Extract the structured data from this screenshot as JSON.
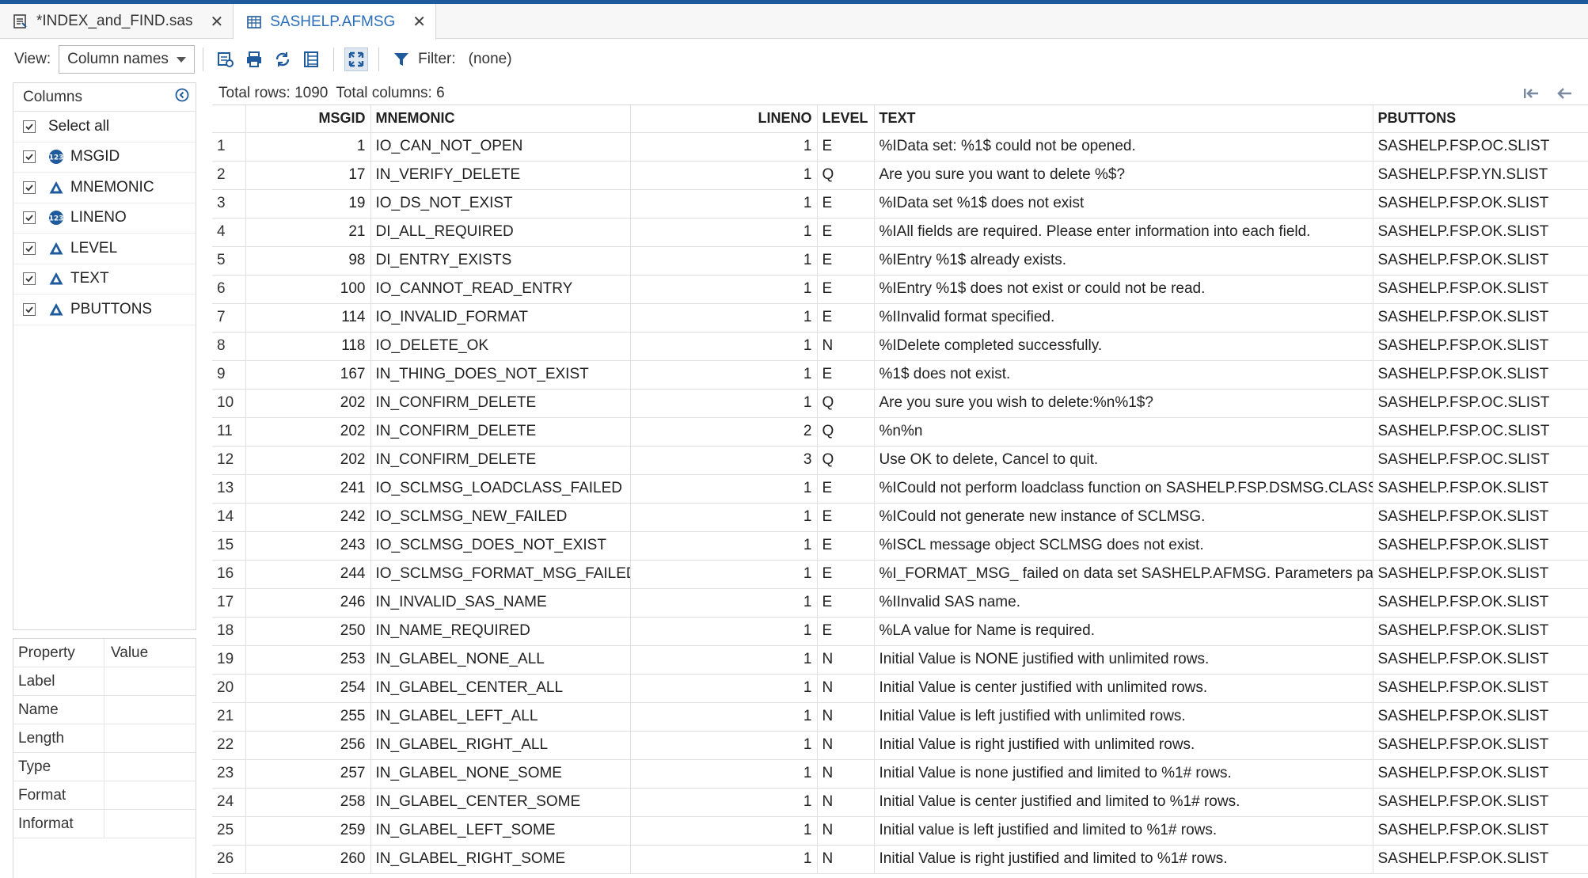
{
  "tabs": [
    {
      "label": "*INDEX_and_FIND.sas",
      "active": false,
      "icon": "sas-program-icon"
    },
    {
      "label": "SASHELP.AFMSG",
      "active": true,
      "icon": "table-icon"
    }
  ],
  "toolbar": {
    "view_label": "View:",
    "view_value": "Column names",
    "filter_label": "Filter:",
    "filter_value": "(none)"
  },
  "columns_panel": {
    "title": "Columns",
    "select_all": "Select all",
    "items": [
      {
        "name": "MSGID",
        "type": "numeric"
      },
      {
        "name": "MNEMONIC",
        "type": "character"
      },
      {
        "name": "LINENO",
        "type": "numeric"
      },
      {
        "name": "LEVEL",
        "type": "character"
      },
      {
        "name": "TEXT",
        "type": "character"
      },
      {
        "name": "PBUTTONS",
        "type": "character"
      }
    ]
  },
  "properties_panel": {
    "header_property": "Property",
    "header_value": "Value",
    "rows": [
      "Label",
      "Name",
      "Length",
      "Type",
      "Format",
      "Informat"
    ]
  },
  "summary": {
    "total_rows": "Total rows: 1090",
    "total_columns": "Total columns: 6"
  },
  "grid": {
    "headers": [
      "",
      "MSGID",
      "MNEMONIC",
      "LINENO",
      "LEVEL",
      "TEXT",
      "PBUTTONS"
    ],
    "rows": [
      [
        "1",
        "1",
        "IO_CAN_NOT_OPEN",
        "1",
        "E",
        "%IData set: %1$ could not be opened.",
        "SASHELP.FSP.OC.SLIST"
      ],
      [
        "2",
        "17",
        "IN_VERIFY_DELETE",
        "1",
        "Q",
        "Are you sure you want to delete %$?",
        "SASHELP.FSP.YN.SLIST"
      ],
      [
        "3",
        "19",
        "IO_DS_NOT_EXIST",
        "1",
        "E",
        "%IData set %1$ does not exist",
        "SASHELP.FSP.OK.SLIST"
      ],
      [
        "4",
        "21",
        "DI_ALL_REQUIRED",
        "1",
        "E",
        "%IAll fields are required. Please enter information into each field.",
        "SASHELP.FSP.OK.SLIST"
      ],
      [
        "5",
        "98",
        "DI_ENTRY_EXISTS",
        "1",
        "E",
        "%IEntry %1$ already exists.",
        "SASHELP.FSP.OK.SLIST"
      ],
      [
        "6",
        "100",
        "IO_CANNOT_READ_ENTRY",
        "1",
        "E",
        "%IEntry %1$ does not exist or could not be read.",
        "SASHELP.FSP.OK.SLIST"
      ],
      [
        "7",
        "114",
        "IO_INVALID_FORMAT",
        "1",
        "E",
        "%IInvalid format specified.",
        "SASHELP.FSP.OK.SLIST"
      ],
      [
        "8",
        "118",
        "IO_DELETE_OK",
        "1",
        "N",
        "%IDelete completed successfully.",
        "SASHELP.FSP.OK.SLIST"
      ],
      [
        "9",
        "167",
        "IN_THING_DOES_NOT_EXIST",
        "1",
        "E",
        "%1$ does not exist.",
        "SASHELP.FSP.OK.SLIST"
      ],
      [
        "10",
        "202",
        "IN_CONFIRM_DELETE",
        "1",
        "Q",
        "Are you sure you wish to delete:%n%1$?",
        "SASHELP.FSP.OC.SLIST"
      ],
      [
        "11",
        "202",
        "IN_CONFIRM_DELETE",
        "2",
        "Q",
        "%n%n",
        "SASHELP.FSP.OC.SLIST"
      ],
      [
        "12",
        "202",
        "IN_CONFIRM_DELETE",
        "3",
        "Q",
        "Use OK to delete, Cancel to quit.",
        "SASHELP.FSP.OC.SLIST"
      ],
      [
        "13",
        "241",
        "IO_SCLMSG_LOADCLASS_FAILED",
        "1",
        "E",
        "%ICould not perform loadclass function on SASHELP.FSP.DSMSG.CLASS",
        "SASHELP.FSP.OK.SLIST"
      ],
      [
        "14",
        "242",
        "IO_SCLMSG_NEW_FAILED",
        "1",
        "E",
        "%ICould not generate new instance of SCLMSG.",
        "SASHELP.FSP.OK.SLIST"
      ],
      [
        "15",
        "243",
        "IO_SCLMSG_DOES_NOT_EXIST",
        "1",
        "E",
        "%ISCL message object SCLMSG does not exist.",
        "SASHELP.FSP.OK.SLIST"
      ],
      [
        "16",
        "244",
        "IO_SCLMSG_FORMAT_MSG_FAILED",
        "1",
        "E",
        "%I_FORMAT_MSG_ failed on data set SASHELP.AFMSG.  Parameters passed w",
        "SASHELP.FSP.OK.SLIST"
      ],
      [
        "17",
        "246",
        "IN_INVALID_SAS_NAME",
        "1",
        "E",
        "%IInvalid SAS name.",
        "SASHELP.FSP.OK.SLIST"
      ],
      [
        "18",
        "250",
        "IN_NAME_REQUIRED",
        "1",
        "E",
        "%LA value for Name is required.",
        "SASHELP.FSP.OK.SLIST"
      ],
      [
        "19",
        "253",
        "IN_GLABEL_NONE_ALL",
        "1",
        "N",
        "Initial Value is NONE justified with unlimited rows.",
        "SASHELP.FSP.OK.SLIST"
      ],
      [
        "20",
        "254",
        "IN_GLABEL_CENTER_ALL",
        "1",
        "N",
        "Initial Value is center justified with unlimited rows.",
        "SASHELP.FSP.OK.SLIST"
      ],
      [
        "21",
        "255",
        "IN_GLABEL_LEFT_ALL",
        "1",
        "N",
        "Initial Value is left justified with unlimited rows.",
        "SASHELP.FSP.OK.SLIST"
      ],
      [
        "22",
        "256",
        "IN_GLABEL_RIGHT_ALL",
        "1",
        "N",
        "Initial Value is right justified with unlimited rows.",
        "SASHELP.FSP.OK.SLIST"
      ],
      [
        "23",
        "257",
        "IN_GLABEL_NONE_SOME",
        "1",
        "N",
        "Initial Value is none justified and limited to %1# rows.",
        "SASHELP.FSP.OK.SLIST"
      ],
      [
        "24",
        "258",
        "IN_GLABEL_CENTER_SOME",
        "1",
        "N",
        "Initial Value is center justified and limited to %1# rows.",
        "SASHELP.FSP.OK.SLIST"
      ],
      [
        "25",
        "259",
        "IN_GLABEL_LEFT_SOME",
        "1",
        "N",
        "Initial value is left justified and limited to %1# rows.",
        "SASHELP.FSP.OK.SLIST"
      ],
      [
        "26",
        "260",
        "IN_GLABEL_RIGHT_SOME",
        "1",
        "N",
        "Initial Value is right justified and limited to %1# rows.",
        "SASHELP.FSP.OK.SLIST"
      ]
    ]
  },
  "colors": {
    "accent": "#2a6ebb",
    "topbar": "#1f5b9c",
    "icon_blue": "#1f5b9c"
  }
}
